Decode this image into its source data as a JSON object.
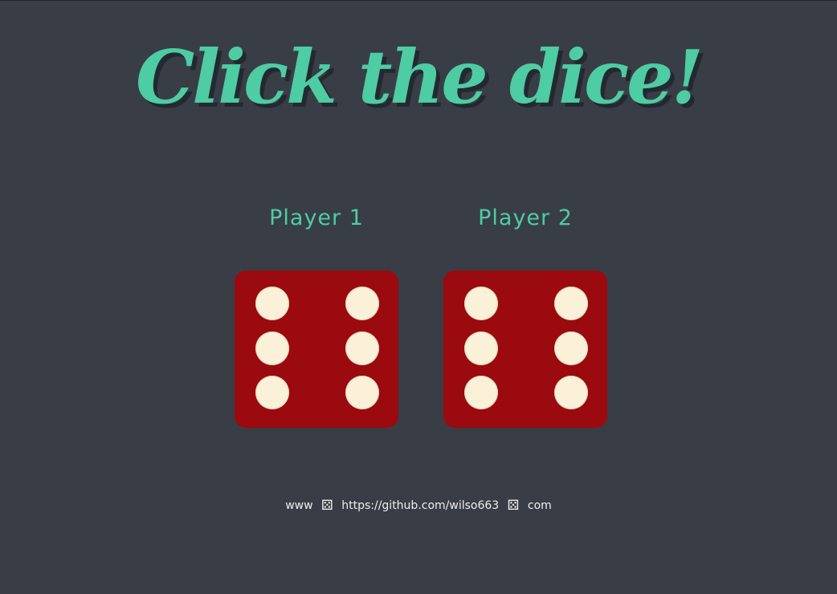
{
  "title": "Click the dice!",
  "players": [
    {
      "label": "Player 1",
      "die_value": 6
    },
    {
      "label": "Player 2",
      "die_value": 6
    }
  ],
  "footer": {
    "part1": "www",
    "part2": "https://github.com/wilso663",
    "part3": "com",
    "separator_icon": "⚄"
  },
  "colors": {
    "background": "#393E46",
    "accent": "#4ECCA3",
    "die": "#9B0A0E",
    "pip": "#FBF0D8"
  }
}
